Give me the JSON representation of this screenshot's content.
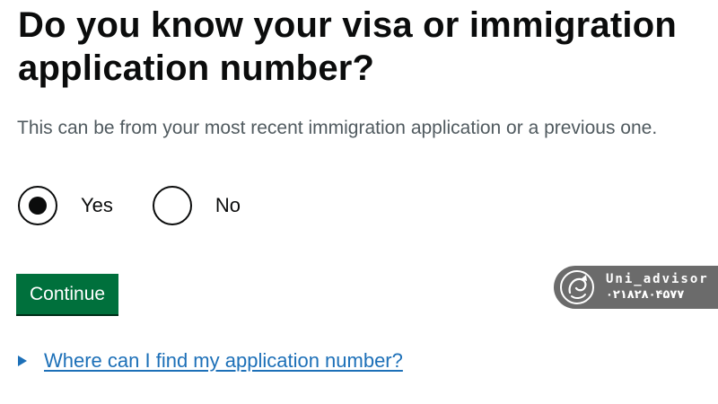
{
  "question": {
    "heading": "Do you know your visa or immigration application number?",
    "hint": "This can be from your most recent immigration application or a previous one."
  },
  "options": [
    {
      "label": "Yes",
      "selected": true
    },
    {
      "label": "No",
      "selected": false
    }
  ],
  "actions": {
    "continue_label": "Continue"
  },
  "details": {
    "summary_text": "Where can I find my application number?"
  },
  "watermark": {
    "name": "Uni_advisor",
    "phone": "۰۲۱۸۲۸۰۴۵۷۷",
    "logo_icon": "uni-advisor-logo-icon",
    "background_color": "#6b6b6b"
  },
  "colors": {
    "button_green": "#00703c",
    "link_blue": "#1d70b8",
    "hint_grey": "#505a5f",
    "text": "#0b0c0c"
  }
}
